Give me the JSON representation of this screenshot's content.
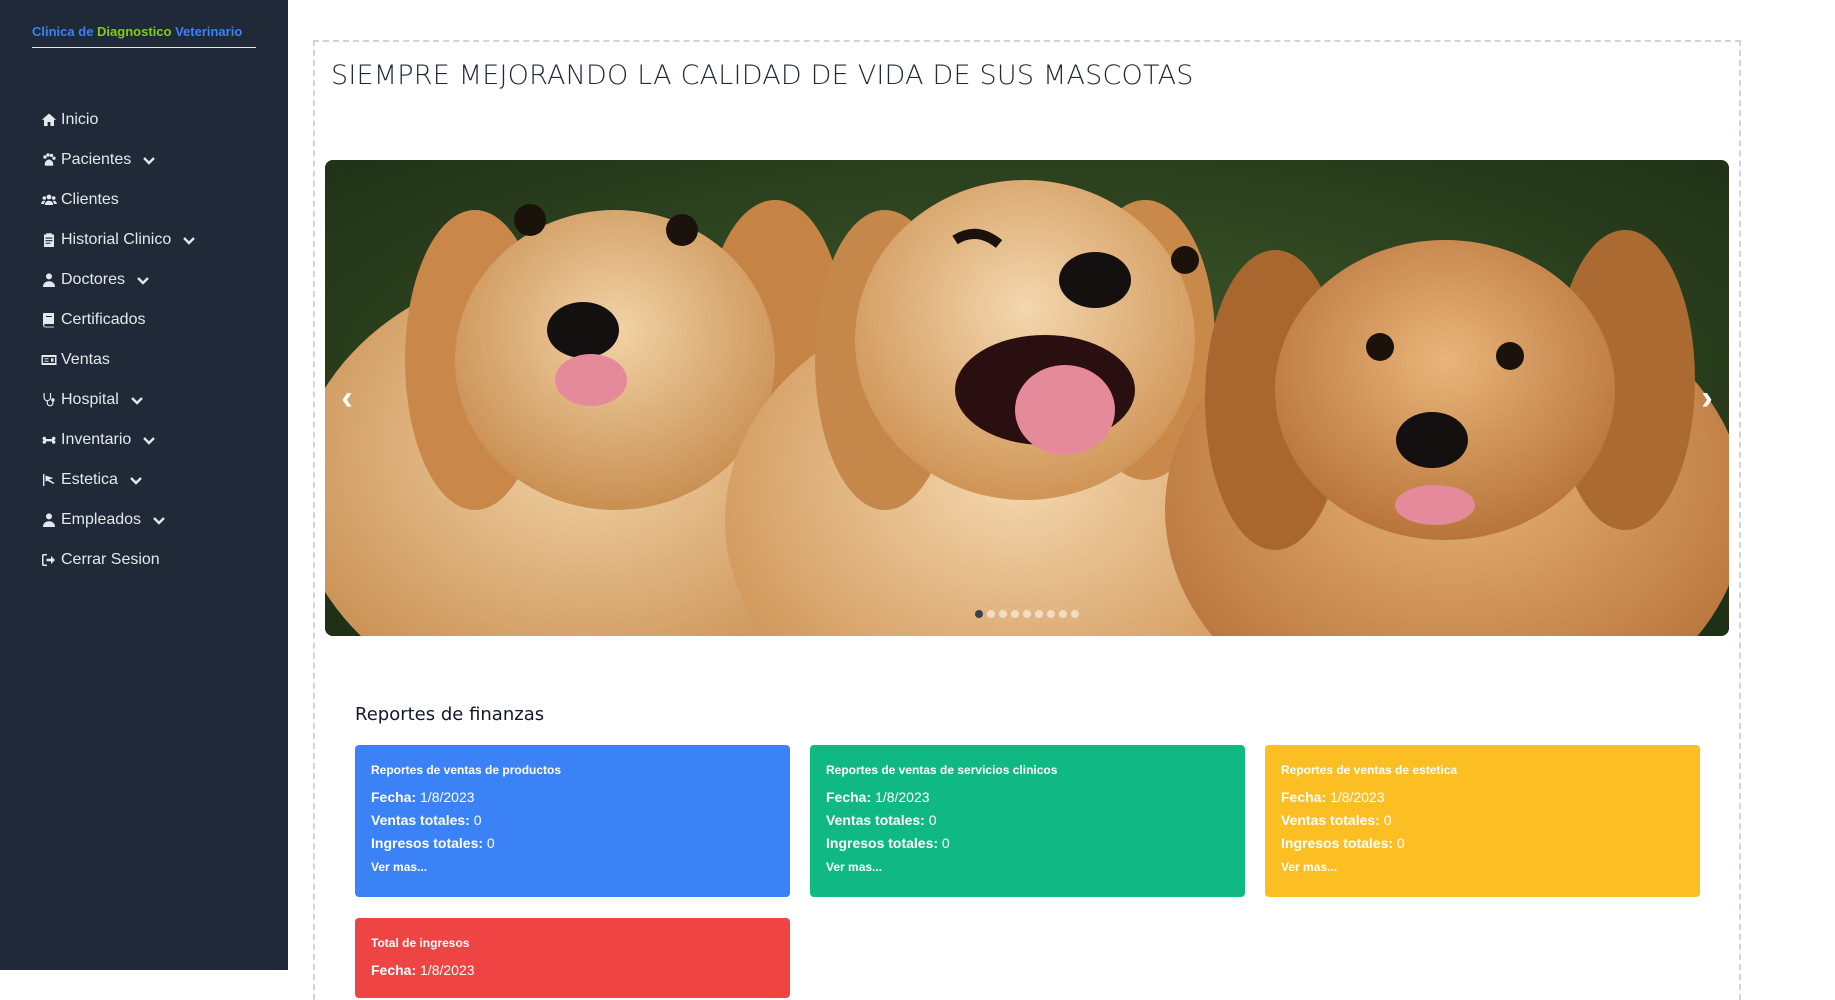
{
  "brand": {
    "w1": "Clinica",
    "w2": "de",
    "w3": "Diagnostico",
    "w4": "Veterinario"
  },
  "nav": {
    "items": [
      {
        "label": "Inicio",
        "icon": "home-icon",
        "dropdown": false
      },
      {
        "label": "Pacientes",
        "icon": "paw-icon",
        "dropdown": true
      },
      {
        "label": "Clientes",
        "icon": "users-icon",
        "dropdown": false
      },
      {
        "label": "Historial Clinico",
        "icon": "clipboard-icon",
        "dropdown": true
      },
      {
        "label": "Doctores",
        "icon": "user-doctor-icon",
        "dropdown": true
      },
      {
        "label": "Certificados",
        "icon": "book-icon",
        "dropdown": false
      },
      {
        "label": "Ventas",
        "icon": "money-bill-icon",
        "dropdown": false
      },
      {
        "label": "Hospital",
        "icon": "stethoscope-icon",
        "dropdown": true
      },
      {
        "label": "Inventario",
        "icon": "bone-icon",
        "dropdown": true
      },
      {
        "label": "Estetica",
        "icon": "scissors-icon",
        "dropdown": true
      },
      {
        "label": "Empleados",
        "icon": "user-tie-icon",
        "dropdown": true
      },
      {
        "label": "Cerrar Sesion",
        "icon": "sign-out-icon",
        "dropdown": false
      }
    ]
  },
  "main": {
    "headline": "SIEMPRE MEJORANDO LA CALIDAD DE VIDA DE SUS MASCOTAS",
    "carousel": {
      "prev": "‹",
      "next": "›",
      "slide_count": 9,
      "active_slide": 1
    },
    "finance_title": "Reportes de finanzas",
    "cards": [
      {
        "title": "Reportes de ventas de productos",
        "fecha_label": "Fecha:",
        "fecha": "1/8/2023",
        "ventas_label": "Ventas totales:",
        "ventas": "0",
        "ingresos_label": "Ingresos totales:",
        "ingresos": "0",
        "more": "Ver mas...",
        "color": "#3b82f6"
      },
      {
        "title": "Reportes de ventas de servicios clinicos",
        "fecha_label": "Fecha:",
        "fecha": "1/8/2023",
        "ventas_label": "Ventas totales:",
        "ventas": "0",
        "ingresos_label": "Ingresos totales:",
        "ingresos": "0",
        "more": "Ver mas...",
        "color": "#10b981"
      },
      {
        "title": "Reportes de ventas de estetica",
        "fecha_label": "Fecha:",
        "fecha": "1/8/2023",
        "ventas_label": "Ventas totales:",
        "ventas": "0",
        "ingresos_label": "Ingresos totales:",
        "ingresos": "0",
        "more": "Ver mas...",
        "color": "#fbbf24"
      },
      {
        "title": "Total de ingresos",
        "fecha_label": "Fecha:",
        "fecha": "1/8/2023",
        "color": "#ef4444"
      }
    ]
  }
}
